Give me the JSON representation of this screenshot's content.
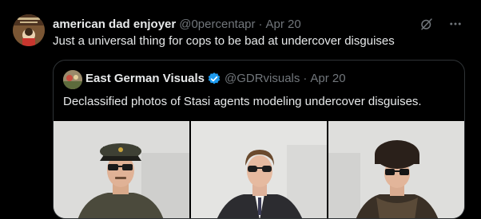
{
  "tweet": {
    "author_name": "american dad enjoyer",
    "handle": "@0percentapr",
    "separator": "·",
    "date": "Apr 20",
    "text": "Just a universal thing for cops to be bad at undercover disguises",
    "avatar_icon": "avatar-image",
    "actions": {
      "grok_icon": "grok-icon",
      "more_icon": "more-icon"
    }
  },
  "quote": {
    "author_name": "East German Visuals",
    "verified_icon": "verified-badge-icon",
    "handle": "@GDRvisuals",
    "separator": "·",
    "date": "Apr 20",
    "text": "Declassified photos of Stasi agents modeling undercover disguises.",
    "photos": [
      {
        "name": "photo-agent-uniform-cap"
      },
      {
        "name": "photo-agent-suit"
      },
      {
        "name": "photo-agent-fur-hat"
      }
    ]
  },
  "colors": {
    "background": "#000000",
    "primary_text": "#e7e9ea",
    "secondary_text": "#71767b",
    "border": "#2f3336",
    "verified": "#1d9bf0"
  }
}
